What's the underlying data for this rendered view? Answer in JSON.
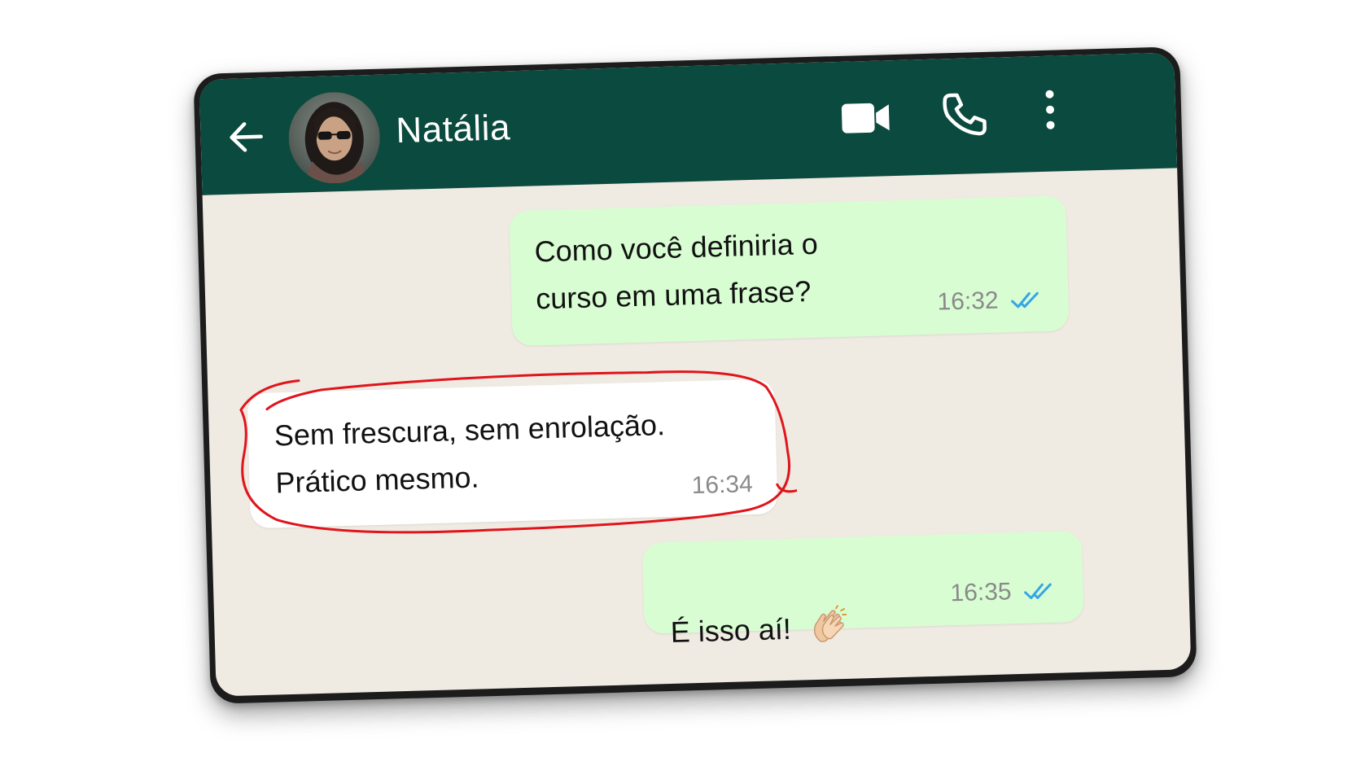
{
  "header": {
    "contact_name": "Natália",
    "icons": {
      "back": "arrow-left-icon",
      "video": "video-camera-icon",
      "call": "phone-icon",
      "menu": "more-vertical-icon"
    },
    "background_color": "#0b4a3e"
  },
  "chat": {
    "background_color": "#efeae2",
    "messages": [
      {
        "direction": "outgoing",
        "text": "Como você definiria o\ncurso em uma frase?",
        "time": "16:32",
        "status_icon": "double-check-read-icon"
      },
      {
        "direction": "incoming",
        "text": "Sem frescura, sem enrolação.\nPrático mesmo.",
        "time": "16:34",
        "highlighted": true
      },
      {
        "direction": "outgoing",
        "text": "É isso aí!",
        "emoji": "clapping-hands-icon",
        "time": "16:35",
        "status_icon": "double-check-read-icon"
      }
    ]
  },
  "colors": {
    "outgoing_bubble": "#d9fdd3",
    "incoming_bubble": "#ffffff",
    "read_ticks": "#34a6e8",
    "highlight_marker": "#e0141b"
  }
}
